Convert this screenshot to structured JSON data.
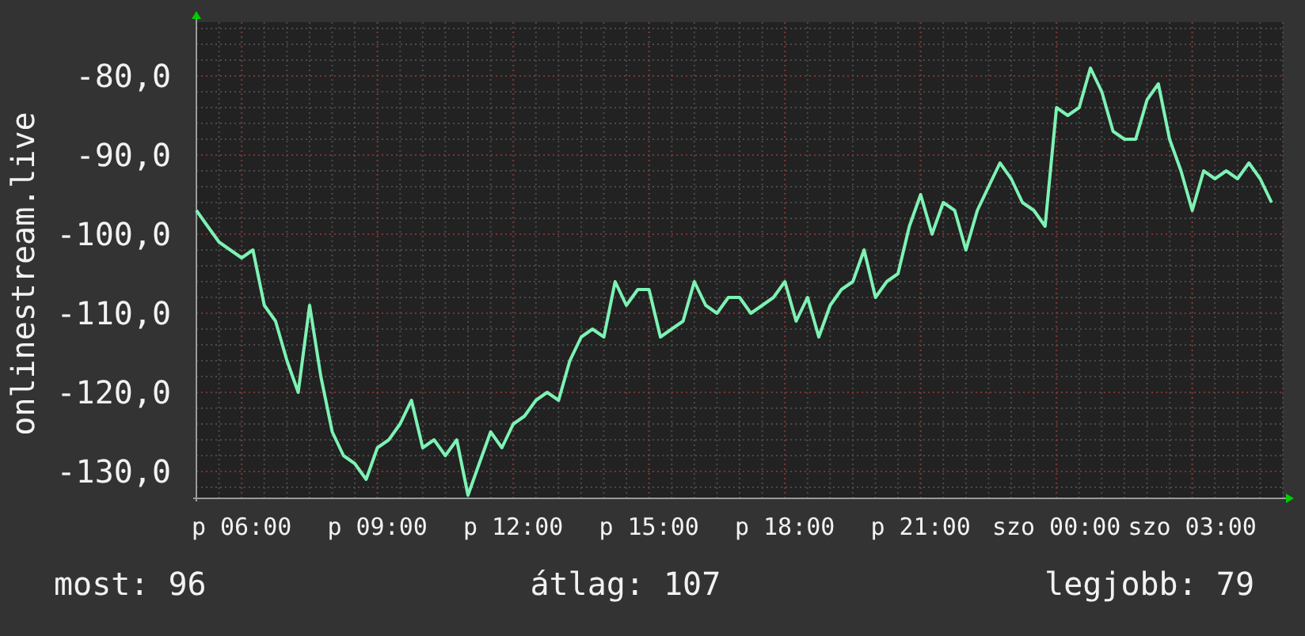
{
  "chart_data": {
    "type": "line",
    "grid": true,
    "ylabel": "onlinestream.live",
    "ylim": [
      -133.4,
      -73.2
    ],
    "yticks": [
      {
        "value": -80,
        "label": "-80,0"
      },
      {
        "value": -90,
        "label": "-90,0"
      },
      {
        "value": -100,
        "label": "-100,0"
      },
      {
        "value": -110,
        "label": "-110,0"
      },
      {
        "value": -120,
        "label": "-120,0"
      },
      {
        "value": -130,
        "label": "-130,0"
      }
    ],
    "categories": [
      null,
      null,
      null,
      null,
      "p 06:00",
      null,
      null,
      null,
      null,
      null,
      null,
      null,
      null,
      null,
      null,
      null,
      "p 09:00",
      null,
      null,
      null,
      null,
      null,
      null,
      null,
      null,
      null,
      null,
      null,
      "p 12:00",
      null,
      null,
      null,
      null,
      null,
      null,
      null,
      null,
      null,
      null,
      null,
      "p 15:00",
      null,
      null,
      null,
      null,
      null,
      null,
      null,
      null,
      null,
      null,
      null,
      "p 18:00",
      null,
      null,
      null,
      null,
      null,
      null,
      null,
      null,
      null,
      null,
      null,
      "p 21:00",
      null,
      null,
      null,
      null,
      null,
      null,
      null,
      null,
      null,
      null,
      null,
      "szo 00:00",
      null,
      null,
      null,
      null,
      null,
      null,
      null,
      null,
      null,
      null,
      null,
      "szo 03:00",
      null,
      null,
      null,
      null,
      null,
      null,
      null
    ],
    "series": [
      {
        "color": "#7df2b4",
        "values": [
          -97,
          -99,
          -101,
          -102,
          -103,
          -102,
          -109,
          -111,
          -116,
          -120,
          -109,
          -118,
          -125,
          -128,
          -129,
          -131,
          -127,
          -126,
          -124,
          -121,
          -127,
          -126,
          -128,
          -126,
          -133,
          -129,
          -125,
          -127,
          -124,
          -123,
          -121,
          -120,
          -121,
          -116,
          -113,
          -112,
          -113,
          -106,
          -109,
          -107,
          -107,
          -113,
          -112,
          -111,
          -106,
          -109,
          -110,
          -108,
          -108,
          -110,
          -109,
          -108,
          -106,
          -111,
          -108,
          -113,
          -109,
          -107,
          -106,
          -102,
          -108,
          -106,
          -105,
          -99,
          -95,
          -100,
          -96,
          -97,
          -102,
          -97,
          -94,
          -91,
          -93,
          -96,
          -97,
          -99,
          -84,
          -85,
          -84,
          -79,
          -82,
          -87,
          -88,
          -88,
          -83,
          -81,
          -88,
          -92,
          -97,
          -92,
          -93,
          -92,
          -93,
          -91,
          -93,
          -96
        ]
      }
    ]
  },
  "legend": [
    {
      "label": "most: 96"
    },
    {
      "label": "átlag: 107"
    },
    {
      "label": "legjobb: 79"
    }
  ]
}
